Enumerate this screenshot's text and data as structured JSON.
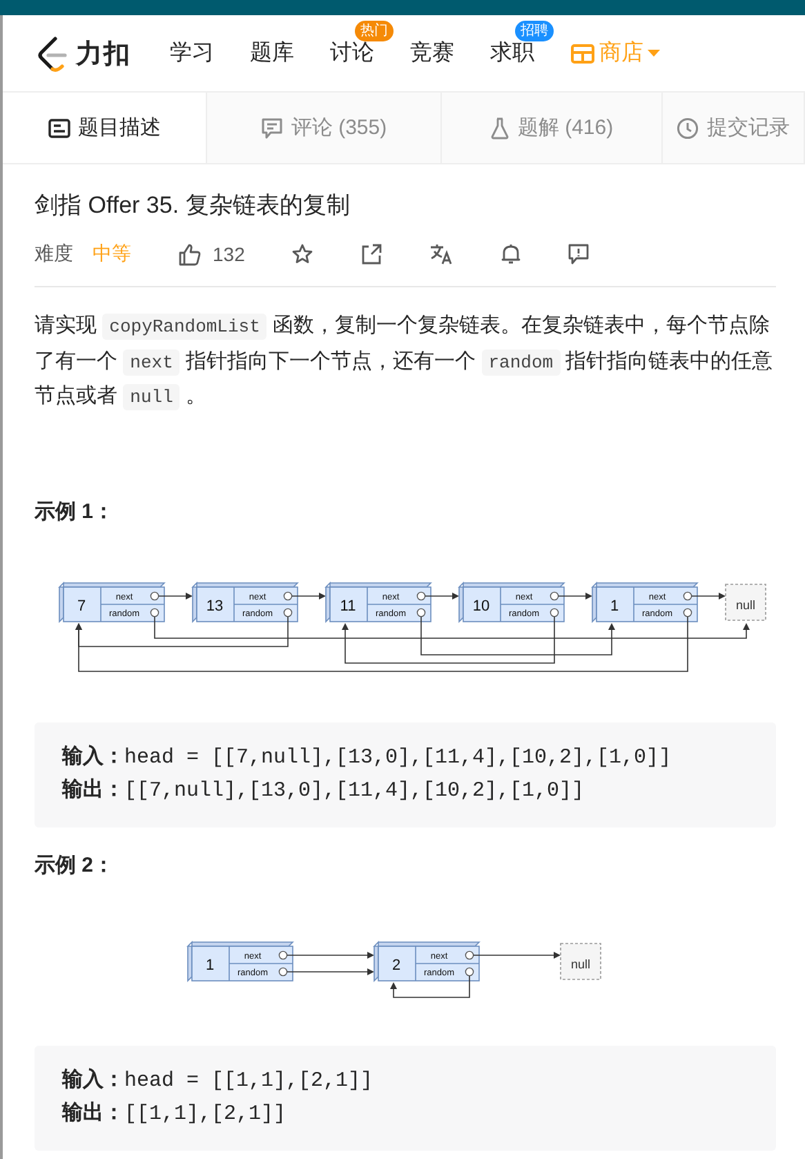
{
  "nav": {
    "logo_text": "力扣",
    "items": [
      {
        "label": "学习",
        "kind": "link"
      },
      {
        "label": "题库",
        "kind": "link"
      },
      {
        "label": "讨论",
        "kind": "link",
        "badge": "热门",
        "color": "#f58a07"
      },
      {
        "label": "竞赛",
        "kind": "link"
      },
      {
        "label": "求职",
        "kind": "link",
        "badge": "招聘",
        "color": "#1a90ff"
      },
      {
        "label": "商店",
        "kind": "store"
      }
    ]
  },
  "tabs": [
    {
      "label": "题目描述",
      "selected": true
    },
    {
      "label": "评论 (355)",
      "selected": false
    },
    {
      "label": "题解 (416)",
      "selected": false
    },
    {
      "label": "提交记录",
      "selected": false
    }
  ],
  "problem": {
    "title": "剑指 Offer 35. 复杂链表的复制",
    "difficulty_label": "难度",
    "difficulty": "中等",
    "likes": "132",
    "description": [
      {
        "kind": "text",
        "text": "请实现 "
      },
      {
        "kind": "code",
        "text": "copyRandomList"
      },
      {
        "kind": "text",
        "text": " 函数，复制一个复杂链表。在复杂链表中，每个节点除了有一个 "
      },
      {
        "kind": "code",
        "text": "next"
      },
      {
        "kind": "text",
        "text": " 指针指向下一个节点，还有一个 "
      },
      {
        "kind": "code",
        "text": "random"
      },
      {
        "kind": "text",
        "text": " 指针指向链表中的任意节点或者 "
      },
      {
        "kind": "code",
        "text": "null"
      },
      {
        "kind": "text",
        "text": " 。"
      }
    ]
  },
  "examples": [
    {
      "heading": "示例 1：",
      "diagram": {
        "null_label": "null",
        "nodes": [
          {
            "value": "7",
            "next_label": "next",
            "random_label": "random"
          },
          {
            "value": "13",
            "next_label": "next",
            "random_label": "random"
          },
          {
            "value": "11",
            "next_label": "next",
            "random_label": "random"
          },
          {
            "value": "10",
            "next_label": "next",
            "random_label": "random"
          },
          {
            "value": "1",
            "next_label": "next",
            "random_label": "random"
          }
        ]
      },
      "lines": [
        "**输入：**head = [[7,null],[13,0],[11,4],[10,2],[1,0]]",
        "**输出：**[[7,null],[13,0],[11,4],[10,2],[1,0]]"
      ]
    },
    {
      "heading": "示例 2：",
      "diagram": {
        "null_label": "null",
        "nodes": [
          {
            "value": "1",
            "next_label": "next",
            "random_label": "random"
          },
          {
            "value": "2",
            "next_label": "next",
            "random_label": "random"
          }
        ]
      },
      "lines": [
        "**输入：**head = [[1,1],[2,1]]",
        "**输出：**[[1,1],[2,1]]"
      ]
    }
  ]
}
